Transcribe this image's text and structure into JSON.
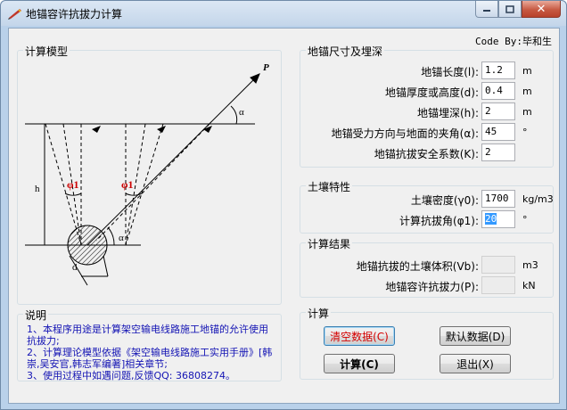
{
  "window": {
    "title": "地锚容许抗拔力计算",
    "code_by": "Code By:毕和生"
  },
  "model": {
    "title": "计算模型",
    "labels": {
      "p": "P",
      "alpha_top": "α",
      "alpha_bottom": "α",
      "h": "h",
      "d": "d",
      "phi_left": "φ1",
      "phi_right": "φ1"
    }
  },
  "dimensions": {
    "title": "地锚尺寸及埋深",
    "rows": [
      {
        "label": "地锚长度(l):",
        "value": "1.2",
        "unit": "m"
      },
      {
        "label": "地锚厚度或高度(d):",
        "value": "0.4",
        "unit": "m"
      },
      {
        "label": "地锚埋深(h):",
        "value": "2",
        "unit": "m"
      },
      {
        "label": "地锚受力方向与地面的夹角(α):",
        "value": "45",
        "unit": "°"
      },
      {
        "label": "地锚抗拔安全系数(K):",
        "value": "2",
        "unit": ""
      }
    ]
  },
  "soil": {
    "title": "土壤特性",
    "rows": [
      {
        "label": "土壤密度(γ0):",
        "value": "1700",
        "unit": "kg/m3"
      },
      {
        "label": "计算抗拔角(φ1):",
        "value": "20",
        "unit": "°"
      }
    ]
  },
  "results": {
    "title": "计算结果",
    "rows": [
      {
        "label": "地锚抗拔的土壤体积(Vb):",
        "value": "",
        "unit": "m3"
      },
      {
        "label": "地锚容许抗拔力(P):",
        "value": "",
        "unit": "kN"
      }
    ]
  },
  "notes": {
    "title": "说明",
    "lines": [
      "1、本程序用途是计算架空输电线路施工地锚的允许使用抗拔力;",
      "2、计算理论模型依据《架空输电线路施工实用手册》[韩崇,吴安官,韩志军编著]相关章节;",
      "3、使用过程中如遇问题,反馈QQ: 36808274。"
    ]
  },
  "calc": {
    "title": "计算",
    "clear_label": "清空数据(C)",
    "default_label": "默认数据(D)",
    "calc_label": "计算(C)",
    "exit_label": "退出(X)"
  },
  "colors": {
    "note_text": "#1414b4",
    "clear_text": "#d40000",
    "phi_label": "#cc0000",
    "selection": "#3399ff"
  }
}
